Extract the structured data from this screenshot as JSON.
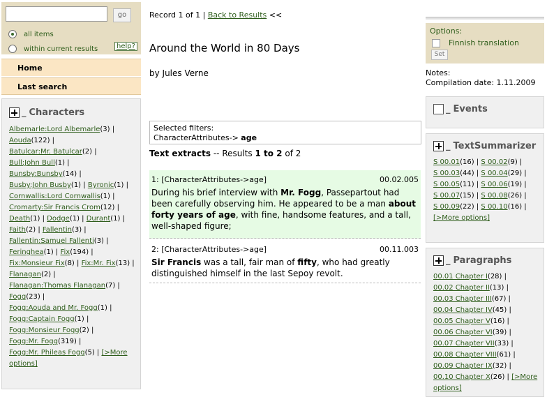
{
  "search": {
    "placeholder": "",
    "go_label": "go",
    "radio_all": "all items",
    "radio_within": "within current results",
    "help": "help?"
  },
  "nav": {
    "home": "Home",
    "last_search": "Last search"
  },
  "characters": {
    "title": "Characters",
    "more": "[>More options]",
    "items": [
      {
        "name": "Albemarle:Lord Albemarle",
        "count": "(3)"
      },
      {
        "name": "Aouda",
        "count": "(122)"
      },
      {
        "name": "Batulcar:Mr. Batulcar",
        "count": "(2)"
      },
      {
        "name": "Bull:John Bull",
        "count": "(1)"
      },
      {
        "name": "Bunsby:Bunsby",
        "count": "(14)"
      },
      {
        "name": "Busby:John Busby",
        "count": "(1)"
      },
      {
        "name": "Byronic",
        "count": "(1)"
      },
      {
        "name": "Cornwallis:Lord Cornwallis",
        "count": "(1)"
      },
      {
        "name": "Cromarty:Sir Francis Crom",
        "count": "(12)"
      },
      {
        "name": "Death",
        "count": "(1)"
      },
      {
        "name": "Dodge",
        "count": "(1)"
      },
      {
        "name": "Durant",
        "count": "(1)"
      },
      {
        "name": "Faith",
        "count": "(2)"
      },
      {
        "name": "Fallentin",
        "count": "(3)"
      },
      {
        "name": "Fallentin:Samuel Fallenti",
        "count": "(3)"
      },
      {
        "name": "Feringhea",
        "count": "(1)"
      },
      {
        "name": "Fix",
        "count": "(194)"
      },
      {
        "name": "Fix:Monsieur Fix",
        "count": "(8)"
      },
      {
        "name": "Fix:Mr. Fix",
        "count": "(13)"
      },
      {
        "name": "Flanagan",
        "count": "(2)"
      },
      {
        "name": "Flanagan:Thomas Flanagan",
        "count": "(7)"
      },
      {
        "name": "Fogg",
        "count": "(23)"
      },
      {
        "name": "Fogg:Aouda and Mr. Fogg",
        "count": "(1)"
      },
      {
        "name": "Fogg:Captain Fogg",
        "count": "(1)"
      },
      {
        "name": "Fogg:Monsieur Fogg",
        "count": "(2)"
      },
      {
        "name": "Fogg:Mr. Fogg",
        "count": "(319)"
      },
      {
        "name": "Fogg:Mr. Phileas Fogg",
        "count": "(5)"
      }
    ]
  },
  "record": {
    "prefix": "Record 1 of 1 |",
    "back": "Back to Results",
    "suffix": "<<"
  },
  "book": {
    "title": "Around the World in 80 Days",
    "author": "by Jules Verne"
  },
  "filters": {
    "label": "Selected filters:",
    "key": "CharacterAttributes->",
    "value": "age"
  },
  "results": {
    "heading": "Text extracts",
    "sep": "-- Results",
    "range": "1 to 2",
    "of": "of 2"
  },
  "extracts": [
    {
      "tag": "1: [CharacterAttributes->age]",
      "ref": "00.02.005",
      "parts": [
        {
          "t": "During his brief interview with ",
          "b": false
        },
        {
          "t": "Mr. Fogg",
          "b": true
        },
        {
          "t": ", Passepartout had been carefully observing him. He appeared to be a man ",
          "b": false
        },
        {
          "t": "about forty years of age",
          "b": true
        },
        {
          "t": ", with fine, handsome features, and a tall, well-shaped figure;",
          "b": false
        }
      ]
    },
    {
      "tag": "2: [CharacterAttributes->age]",
      "ref": "00.11.003",
      "parts": [
        {
          "t": "Sir Francis",
          "b": true
        },
        {
          "t": " was a tall, fair man of ",
          "b": false
        },
        {
          "t": "fifty",
          "b": true
        },
        {
          "t": ", who had greatly distinguished himself in the last Sepoy revolt.",
          "b": false
        }
      ]
    }
  ],
  "options": {
    "title": "Options:",
    "finnish": "Finnish translation",
    "set": "Set"
  },
  "notes": {
    "label": "Notes:",
    "compilation": "Compilation date: 1.11.2009"
  },
  "events": {
    "title": "Events"
  },
  "summarizer": {
    "title": "TextSummarizer",
    "more": "[>More options]",
    "items": [
      {
        "name": "S 00.01",
        "count": "(16)"
      },
      {
        "name": "S 00.02",
        "count": "(9)"
      },
      {
        "name": "S 00.03",
        "count": "(44)"
      },
      {
        "name": "S 00.04",
        "count": "(29)"
      },
      {
        "name": "S 00.05",
        "count": "(11)"
      },
      {
        "name": "S 00.06",
        "count": "(19)"
      },
      {
        "name": "S 00.07",
        "count": "(15)"
      },
      {
        "name": "S 00.08",
        "count": "(26)"
      },
      {
        "name": "S 00.09",
        "count": "(22)"
      },
      {
        "name": "S 00.10",
        "count": "(16)"
      }
    ]
  },
  "paragraphs": {
    "title": "Paragraphs",
    "more": "[>More options]",
    "items": [
      {
        "name": "00.01 Chapter I",
        "count": "(28)"
      },
      {
        "name": "00.02 Chapter II",
        "count": "(13)"
      },
      {
        "name": "00.03 Chapter III",
        "count": "(67)"
      },
      {
        "name": "00.04 Chapter IV",
        "count": "(45)"
      },
      {
        "name": "00.05 Chapter V",
        "count": "(16)"
      },
      {
        "name": "00.06 Chapter VI",
        "count": "(39)"
      },
      {
        "name": "00.07 Chapter VII",
        "count": "(33)"
      },
      {
        "name": "00.08 Chapter VIII",
        "count": "(61)"
      },
      {
        "name": "00.09 Chapter IX",
        "count": "(32)"
      },
      {
        "name": "00.10 Chapter X",
        "count": "(26)"
      }
    ]
  },
  "colors": {
    "accent_link": "#2e5d1b",
    "search_bg": "#e6ddc2",
    "nav_bg": "#fbe6c4",
    "panel_bg": "#f0f0f0",
    "highlight_bg": "#e6fbe4"
  }
}
